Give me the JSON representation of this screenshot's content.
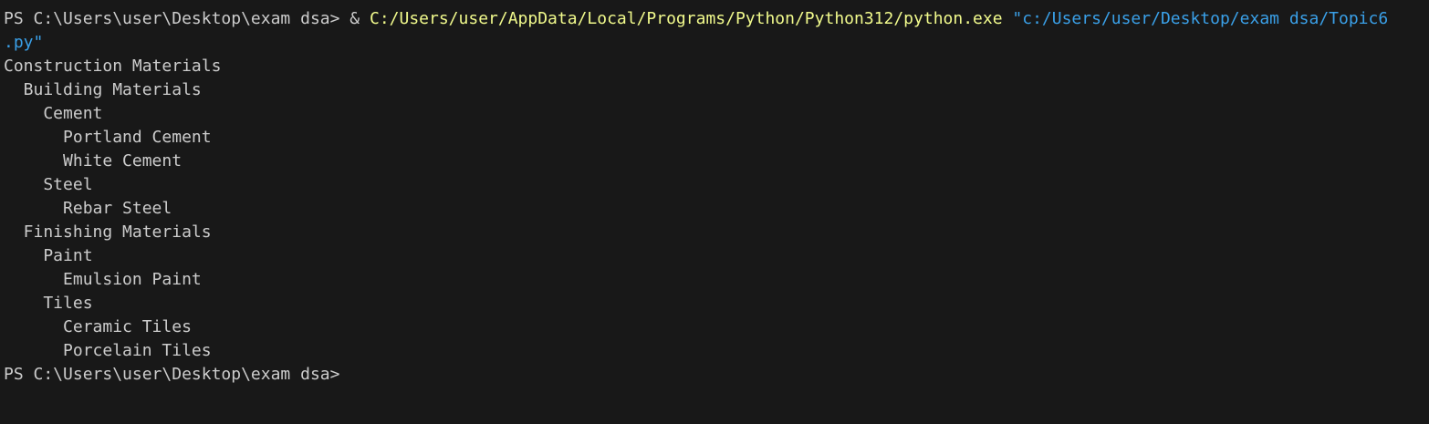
{
  "prompt": {
    "text": "PS C:\\Users\\user\\Desktop\\exam dsa> ",
    "color": "#cccccc"
  },
  "command": {
    "operator": "& ",
    "executable": "C:/Users/user/AppData/Local/Programs/Python/Python312/python.exe",
    "space": " ",
    "argument_line1": "\"c:/Users/user/Desktop/exam dsa/Topic6",
    "argument_line2": ".py\"",
    "executable_color": "#f1fa8c",
    "argument_color": "#3aa0e8",
    "operator_color": "#cccccc"
  },
  "output": {
    "lines": [
      "Construction Materials",
      "  Building Materials",
      "    Cement",
      "      Portland Cement",
      "      White Cement",
      "    Steel",
      "      Rebar Steel",
      "  Finishing Materials",
      "    Paint",
      "      Emulsion Paint",
      "    Tiles",
      "      Ceramic Tiles",
      "      Porcelain Tiles"
    ]
  },
  "final_prompt": {
    "text": "PS C:\\Users\\user\\Desktop\\exam dsa>"
  }
}
